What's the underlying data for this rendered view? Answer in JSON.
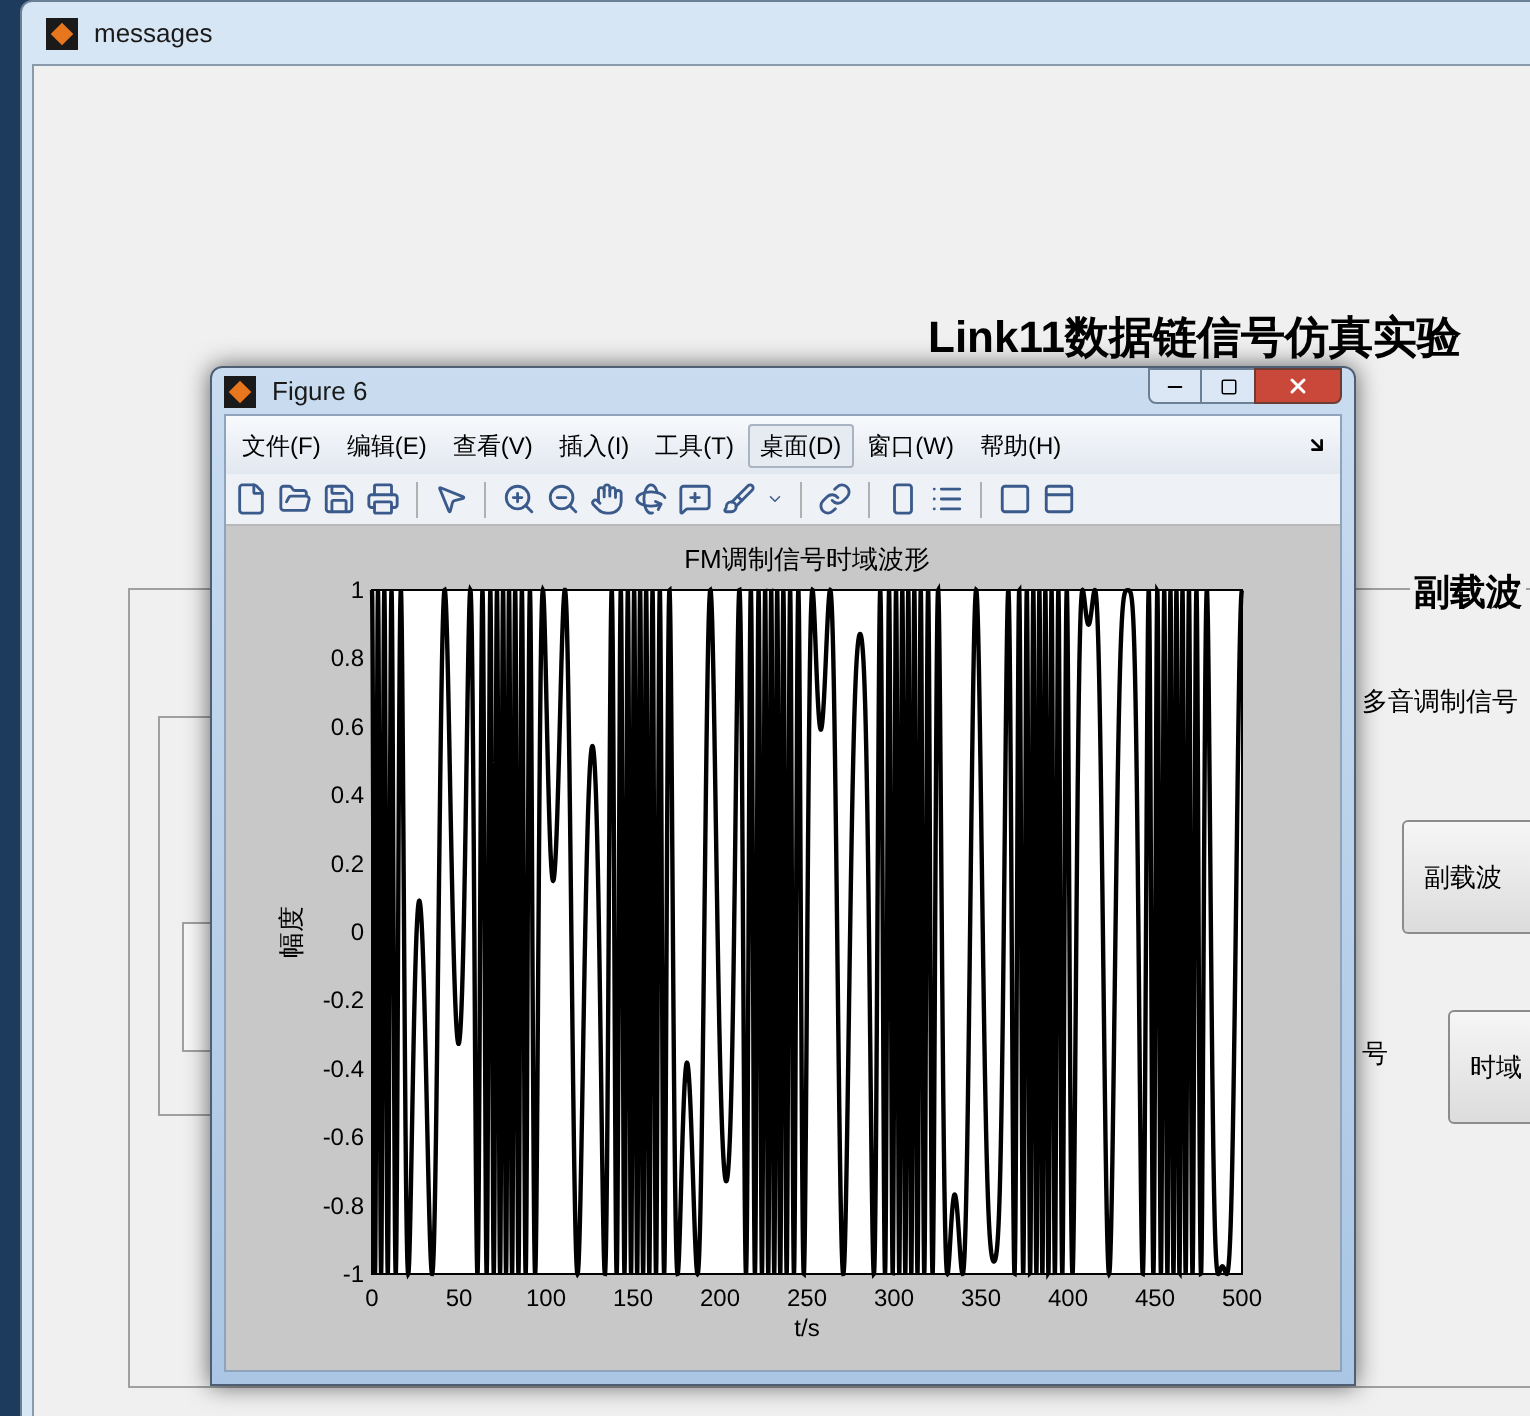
{
  "background_window": {
    "title": "messages",
    "heading": "Link11数据链信号仿真实验",
    "group_title": "副载波",
    "label": "多音调制信号",
    "side_label": "号",
    "buttons": [
      "副载波",
      "时域"
    ]
  },
  "figure_window": {
    "title": "Figure 6",
    "menu": [
      {
        "label": "文件(F)",
        "selected": false
      },
      {
        "label": "编辑(E)",
        "selected": false
      },
      {
        "label": "查看(V)",
        "selected": false
      },
      {
        "label": "插入(I)",
        "selected": false
      },
      {
        "label": "工具(T)",
        "selected": false
      },
      {
        "label": "桌面(D)",
        "selected": true
      },
      {
        "label": "窗口(W)",
        "selected": false
      },
      {
        "label": "帮助(H)",
        "selected": false
      }
    ],
    "plot": {
      "title": "FM调制信号时域波形",
      "xlabel": "t/s",
      "ylabel": "幅度",
      "xticks": [
        "0",
        "50",
        "100",
        "150",
        "200",
        "250",
        "300",
        "350",
        "400",
        "450",
        "500"
      ],
      "yticks": [
        "1",
        "0.8",
        "0.6",
        "0.4",
        "0.2",
        "0",
        "-0.2",
        "-0.4",
        "-0.6",
        "-0.8",
        "-1"
      ]
    }
  }
}
